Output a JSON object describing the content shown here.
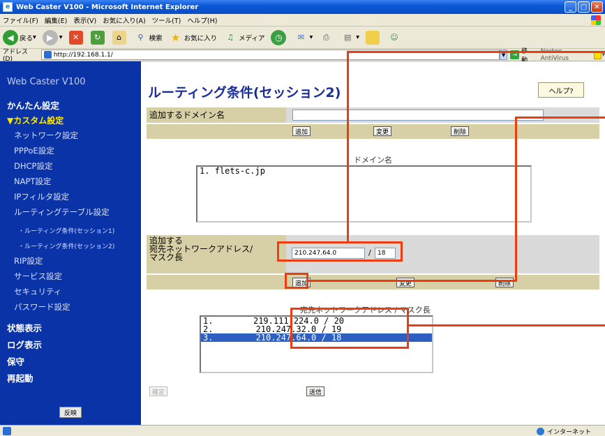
{
  "window": {
    "title": "Web Caster V100 - Microsoft Internet Explorer"
  },
  "menu": [
    "ファイル(F)",
    "編集(E)",
    "表示(V)",
    "お気に入り(A)",
    "ツール(T)",
    "ヘルプ(H)"
  ],
  "toolbar": {
    "back": "戻る",
    "search": "検索",
    "favorites": "お気に入り",
    "media": "メディア"
  },
  "address": {
    "label": "アドレス(D)",
    "url": "http://192.168.1.1/",
    "go": "移動",
    "norton": "Norton AntiVirus"
  },
  "sidebar": {
    "app_title": "Web Caster V100",
    "easy_setup": "かんたん設定",
    "custom_setup": "▼カスタム設定",
    "items": [
      "ネットワーク設定",
      "PPPoE設定",
      "DHCP設定",
      "NAPT設定",
      "IPフィルタ設定",
      "ルーティングテーブル設定"
    ],
    "subitems": [
      "・ルーティング条件(セッション1)",
      "・ルーティング条件(セッション2)"
    ],
    "items2": [
      "RIP設定",
      "サービス設定",
      "セキュリティ",
      "パスワード設定"
    ],
    "bold_items": [
      "状態表示",
      "ログ表示",
      "保守",
      "再起動"
    ],
    "apply_button": "反映"
  },
  "main": {
    "title": "ルーティング条件(セッション2)",
    "help_button": "ヘルプ?",
    "domain_label": "追加するドメイン名",
    "domain_input": "",
    "add_button": "追加",
    "change_button": "変更",
    "delete_button": "削除",
    "domain_list_caption": "ドメイン名",
    "domain_list": [
      {
        "num": "1.",
        "value": "flets-c.jp"
      }
    ],
    "network_label": "追加する\n宛先ネットワークアドレス/\nマスク長",
    "network_address": "210.247.64.0",
    "slash": "/",
    "mask_length": "18",
    "route_list_caption": "宛先ネットワークアドレス / マスク長",
    "route_list": [
      {
        "num": "1.",
        "value": "219.111.224.0 / 20",
        "selected": false
      },
      {
        "num": "2.",
        "value": "210.247.32.0 / 19",
        "selected": false
      },
      {
        "num": "3.",
        "value": "210.247.64.0 / 18",
        "selected": true
      }
    ],
    "confirm_button": "確定",
    "send_button": "送信"
  },
  "status": {
    "zone": "インターネット"
  },
  "colors": {
    "sidebar_bg": "#0b33a8",
    "active_menu": "#ffe800",
    "label_bg": "#d7d0a6",
    "highlight_red": "#ec3d10",
    "selection": "#2c5fc1"
  }
}
